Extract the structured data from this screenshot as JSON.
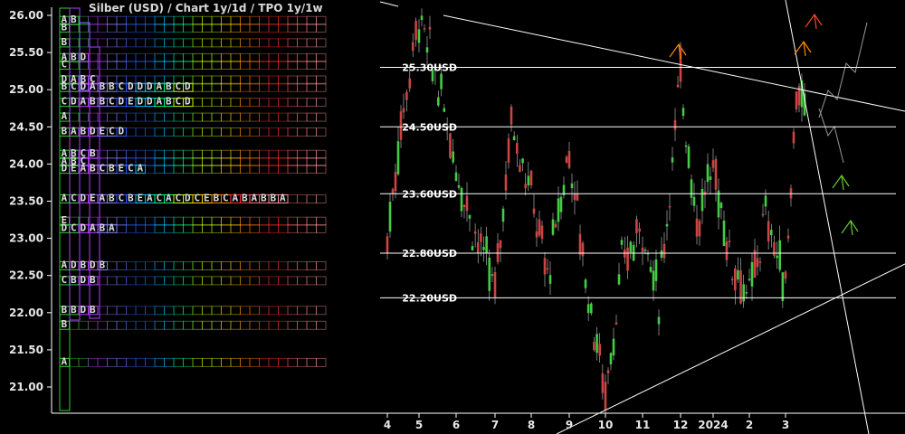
{
  "window": {
    "title": "Silber (USD) /  Chart 1y/1d / TPO 1y/1w"
  },
  "colors": {
    "background": "#000000",
    "axis": "#ffffff",
    "up_candle": "#44cc44",
    "down_candle": "#cc4444",
    "line": "#ffffff"
  },
  "chart_data": {
    "type": "candlestick",
    "title": "Silber (USD) /  Chart 1y/1d / TPO 1y/1w",
    "y_axis": {
      "ticks": [
        "26.00",
        "25.50",
        "25.00",
        "24.50",
        "24.00",
        "23.50",
        "23.00",
        "22.50",
        "22.00",
        "21.50",
        "21.00"
      ],
      "range": [
        20.7,
        26.1
      ]
    },
    "x_axis": {
      "ticks": [
        "4",
        "5",
        "6",
        "7",
        "8",
        "9",
        "10",
        "11",
        "12",
        "2024",
        "2",
        "3"
      ]
    },
    "horizontal_levels": [
      {
        "label": "25.30USD",
        "value": 25.3
      },
      {
        "label": "24.50USD",
        "value": 24.5
      },
      {
        "label": "23.60USD",
        "value": 23.6
      },
      {
        "label": "22.80USD",
        "value": 22.8
      },
      {
        "label": "22.20USD",
        "value": 22.2
      }
    ],
    "price_path": [
      {
        "x": "4",
        "y": 23.0
      },
      {
        "x": "4",
        "y": 24.8
      },
      {
        "x": "5",
        "y": 26.0
      },
      {
        "x": "5",
        "y": 25.2
      },
      {
        "x": "6",
        "y": 24.0
      },
      {
        "x": "6",
        "y": 23.2
      },
      {
        "x": "7",
        "y": 22.3
      },
      {
        "x": "7",
        "y": 24.6
      },
      {
        "x": "8",
        "y": 23.6
      },
      {
        "x": "8",
        "y": 22.5
      },
      {
        "x": "9",
        "y": 24.2
      },
      {
        "x": "9",
        "y": 22.5
      },
      {
        "x": "10",
        "y": 20.9
      },
      {
        "x": "10",
        "y": 22.6
      },
      {
        "x": "11",
        "y": 23.2
      },
      {
        "x": "11",
        "y": 22.2
      },
      {
        "x": "12",
        "y": 25.2
      },
      {
        "x": "12",
        "y": 23.2
      },
      {
        "x": "2024",
        "y": 24.0
      },
      {
        "x": "2024",
        "y": 22.8
      },
      {
        "x": "2",
        "y": 22.2
      },
      {
        "x": "2",
        "y": 23.3
      },
      {
        "x": "3",
        "y": 22.4
      },
      {
        "x": "3",
        "y": 25.0
      },
      {
        "x": "3",
        "y": 24.6
      }
    ],
    "tpo_profile": [
      {
        "price": 25.9,
        "letters": "AB"
      },
      {
        "price": 25.8,
        "letters": "B"
      },
      {
        "price": 25.6,
        "letters": "B"
      },
      {
        "price": 25.4,
        "letters": "ABD"
      },
      {
        "price": 25.3,
        "letters": "C"
      },
      {
        "price": 25.1,
        "letters": "DABC"
      },
      {
        "price": 25.0,
        "letters": "BCDABBCDDDABCD"
      },
      {
        "price": 24.8,
        "letters": "CDABBCDEDDABCD"
      },
      {
        "price": 24.6,
        "letters": "A"
      },
      {
        "price": 24.4,
        "letters": "BABDECD"
      },
      {
        "price": 24.1,
        "letters": "ABCB"
      },
      {
        "price": 24.0,
        "letters": "ABC"
      },
      {
        "price": 23.9,
        "letters": "DEABCBECA"
      },
      {
        "price": 23.5,
        "letters": "ACDEABCBEACACDCEBCABABBA"
      },
      {
        "price": 23.2,
        "letters": "E"
      },
      {
        "price": 23.1,
        "letters": "DCDABA"
      },
      {
        "price": 22.6,
        "letters": "ADBDB"
      },
      {
        "price": 22.4,
        "letters": "CBDB"
      },
      {
        "price": 22.0,
        "letters": "BBDB"
      },
      {
        "price": 21.8,
        "letters": "B"
      },
      {
        "price": 21.3,
        "letters": "A"
      }
    ]
  }
}
